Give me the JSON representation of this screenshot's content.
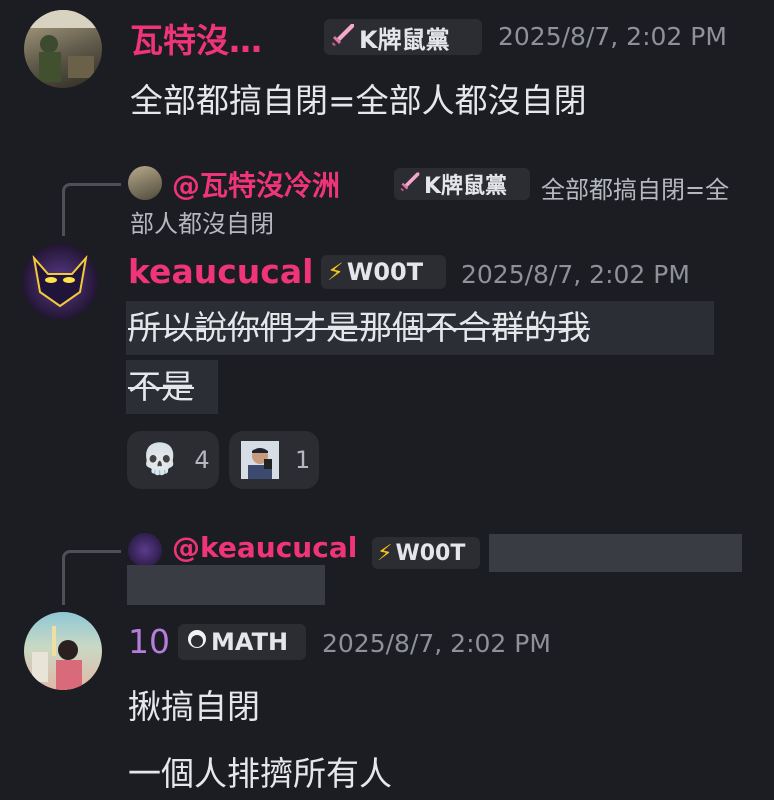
{
  "messages": [
    {
      "author": "瓦特沒…",
      "author_color": "#f0347a",
      "role_tag": "K牌鼠黨",
      "timestamp": "2025/8/7, 2:02 PM",
      "text": "全部都搞自閉=全部人都沒自閉"
    },
    {
      "reply": {
        "author": "@瓦特沒冷洲",
        "role_tag": "K牌鼠黨",
        "preview_line1": "全部都搞自閉=全",
        "preview_line2": "部人都沒自閉"
      },
      "author": "keaucucal",
      "author_color": "#f0347a",
      "role_tag": "W00T",
      "timestamp": "2025/8/7, 2:02 PM",
      "text_line1": "所以說你們才是那個不合群的我",
      "text_line2": "不是",
      "reactions": [
        {
          "emoji": "💀",
          "icon": "skull-emoji",
          "count": "4"
        },
        {
          "icon": "custom-photo-emoji",
          "count": "1"
        }
      ]
    },
    {
      "reply": {
        "author": "@keaucucal",
        "role_tag": "W00T"
      },
      "author": "10",
      "author_color": "#b57edc",
      "role_tag": "MATH",
      "timestamp": "2025/8/7, 2:02 PM",
      "text_line1": "揪搞自閉",
      "text_line2": "一個人排擠所有人"
    }
  ],
  "colors": {
    "background": "#1c1d22",
    "mention": "#f0347a",
    "timestamp": "#8e9199"
  }
}
